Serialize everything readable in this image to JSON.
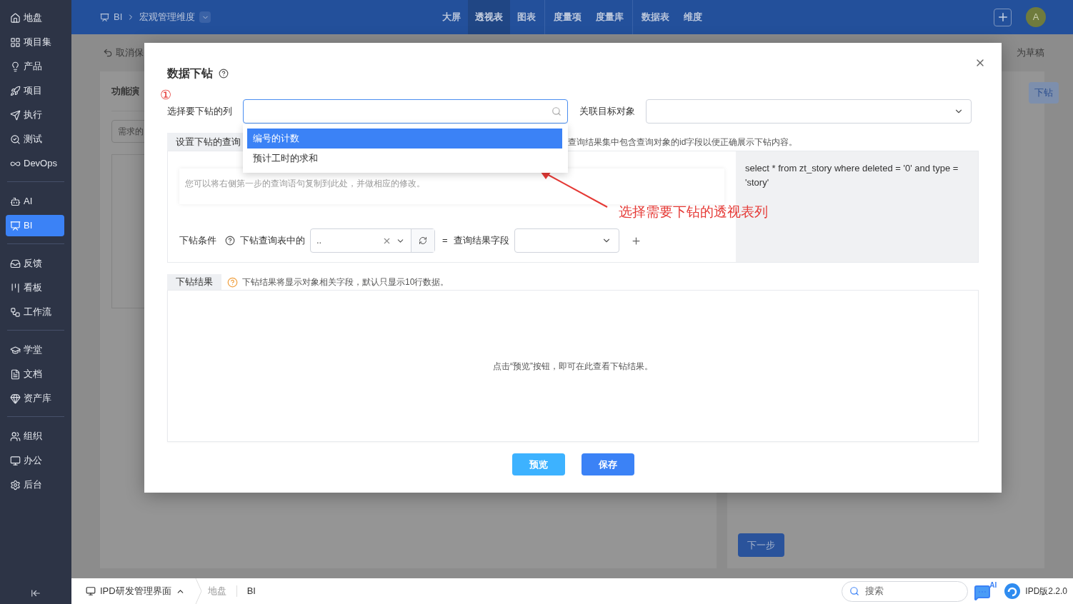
{
  "sidebar": {
    "groups": [
      [
        {
          "label": "地盘",
          "selected": false
        },
        {
          "label": "项目集",
          "selected": false
        },
        {
          "label": "产品",
          "selected": false
        },
        {
          "label": "项目",
          "selected": false
        },
        {
          "label": "执行",
          "selected": false
        },
        {
          "label": "测试",
          "selected": false
        },
        {
          "label": "DevOps",
          "selected": false
        }
      ],
      [
        {
          "label": "AI",
          "selected": false
        },
        {
          "label": "BI",
          "selected": true
        }
      ],
      [
        {
          "label": "反馈",
          "selected": false
        },
        {
          "label": "看板",
          "selected": false
        },
        {
          "label": "工作流",
          "selected": false
        }
      ],
      [
        {
          "label": "学堂",
          "selected": false
        },
        {
          "label": "文档",
          "selected": false
        },
        {
          "label": "资产库",
          "selected": false
        }
      ],
      [
        {
          "label": "组织",
          "selected": false
        },
        {
          "label": "办公",
          "selected": false
        },
        {
          "label": "后台",
          "selected": false
        }
      ]
    ]
  },
  "top_bar": {
    "breadcrumb": [
      "BI",
      "宏观管理维度"
    ],
    "nav_groups": [
      [
        {
          "label": "大屏",
          "selected": false
        },
        {
          "label": "透视表",
          "selected": true
        },
        {
          "label": "图表",
          "selected": false
        }
      ],
      [
        {
          "label": "度量项",
          "selected": false
        },
        {
          "label": "度量库",
          "selected": false
        }
      ],
      [
        {
          "label": "数据表",
          "selected": false
        },
        {
          "label": "维度",
          "selected": false
        }
      ]
    ],
    "avatar": "A"
  },
  "background": {
    "back_link": "取消保",
    "save_draft": "为草稿",
    "section_title": "功能演",
    "filter": "需求的",
    "drill_button": "下钻",
    "next_button": "下一步"
  },
  "dialog": {
    "title": "数据下钻",
    "column_select": {
      "label": "选择要下钻的列",
      "expanded": true,
      "options": [
        {
          "label": "编号的计数",
          "selected": true
        },
        {
          "label": "预计工时的求和",
          "selected": false
        }
      ]
    },
    "target_select": {
      "label": "关联目标对象"
    },
    "query_section": {
      "tab": "设置下钻的查询",
      "hint": "查询结果集中包含查询对象的id字段以便正确展示下钻内容。",
      "placeholder": "您可以将右侧第一步的查询语句复制到此处，并做相应的修改。",
      "condition_label": "下钻条件",
      "table_field_label": "下钻查询表中的",
      "table_field_value": "..",
      "equals": "=",
      "result_field_label": "查询结果字段",
      "sql": "select * from zt_story where deleted = '0' and type = 'story'"
    },
    "result_section": {
      "tab": "下钻结果",
      "hint": "下钻结果将显示对象相关字段，默认只显示10行数据。",
      "empty": "点击“预览”按钮，即可在此查看下钻结果。"
    },
    "buttons": [
      {
        "label": "预览",
        "kind": "secondary"
      },
      {
        "label": "保存",
        "kind": "primary"
      }
    ]
  },
  "annotation": {
    "marker": "①",
    "text": "选择需要下钻的透视表列"
  },
  "footer": {
    "app_menu": "IPD研发管理界面",
    "breadcrumb": [
      "地盘",
      "BI"
    ],
    "search_placeholder": "搜索",
    "ai_badge": "AI",
    "version": "IPD版2.2.0"
  }
}
